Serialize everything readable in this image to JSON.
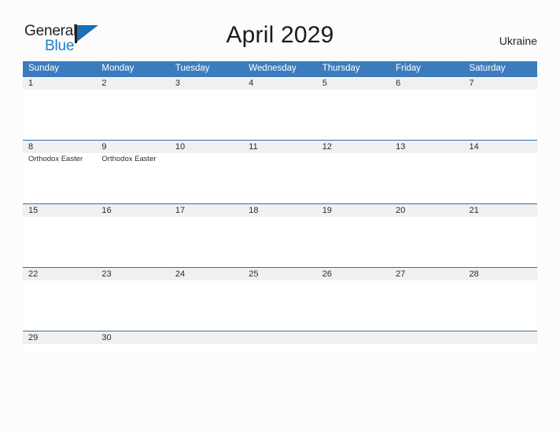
{
  "brand": {
    "name_part1": "General",
    "name_part2": "Blue",
    "mark_icon": "triangle-flag-icon"
  },
  "header": {
    "title": "April 2029",
    "region": "Ukraine"
  },
  "calendar": {
    "day_headers": [
      "Sunday",
      "Monday",
      "Tuesday",
      "Wednesday",
      "Thursday",
      "Friday",
      "Saturday"
    ],
    "colors": {
      "header_blue": "#3a7cbe",
      "row_rule_blue": "#2f6fae",
      "date_band_gray": "#f0f0f0",
      "brand_blue": "#1d7ec4",
      "text_dark": "#2b2b2b",
      "page_background": "#fcfcfd"
    },
    "weeks": [
      [
        {
          "date": "1",
          "events": []
        },
        {
          "date": "2",
          "events": []
        },
        {
          "date": "3",
          "events": []
        },
        {
          "date": "4",
          "events": []
        },
        {
          "date": "5",
          "events": []
        },
        {
          "date": "6",
          "events": []
        },
        {
          "date": "7",
          "events": []
        }
      ],
      [
        {
          "date": "8",
          "events": [
            "Orthodox Easter"
          ]
        },
        {
          "date": "9",
          "events": [
            "Orthodox Easter"
          ]
        },
        {
          "date": "10",
          "events": []
        },
        {
          "date": "11",
          "events": []
        },
        {
          "date": "12",
          "events": []
        },
        {
          "date": "13",
          "events": []
        },
        {
          "date": "14",
          "events": []
        }
      ],
      [
        {
          "date": "15",
          "events": []
        },
        {
          "date": "16",
          "events": []
        },
        {
          "date": "17",
          "events": []
        },
        {
          "date": "18",
          "events": []
        },
        {
          "date": "19",
          "events": []
        },
        {
          "date": "20",
          "events": []
        },
        {
          "date": "21",
          "events": []
        }
      ],
      [
        {
          "date": "22",
          "events": []
        },
        {
          "date": "23",
          "events": []
        },
        {
          "date": "24",
          "events": []
        },
        {
          "date": "25",
          "events": []
        },
        {
          "date": "26",
          "events": []
        },
        {
          "date": "27",
          "events": []
        },
        {
          "date": "28",
          "events": []
        }
      ],
      [
        {
          "date": "29",
          "events": []
        },
        {
          "date": "30",
          "events": []
        },
        {
          "date": "",
          "events": []
        },
        {
          "date": "",
          "events": []
        },
        {
          "date": "",
          "events": []
        },
        {
          "date": "",
          "events": []
        },
        {
          "date": "",
          "events": []
        }
      ]
    ]
  }
}
